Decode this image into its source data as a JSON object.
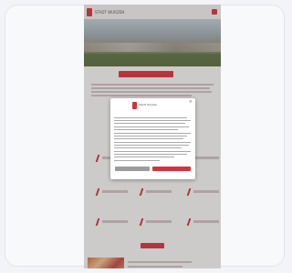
{
  "site": {
    "logo_text": "STADT WURZEN",
    "title_button": "",
    "grid": [
      {
        "label": "present"
      },
      {
        "label": "present"
      },
      {
        "label": ""
      },
      {
        "label": "present"
      },
      {
        "label": "present"
      },
      {
        "label": "present"
      },
      {
        "label": "present"
      },
      {
        "label": "present"
      },
      {
        "label": "present"
      }
    ],
    "section_button": ""
  },
  "modal": {
    "logo_text": "Stadt Wurzen",
    "close": "×",
    "heading": "",
    "decline_button": "",
    "accept_button": ""
  }
}
